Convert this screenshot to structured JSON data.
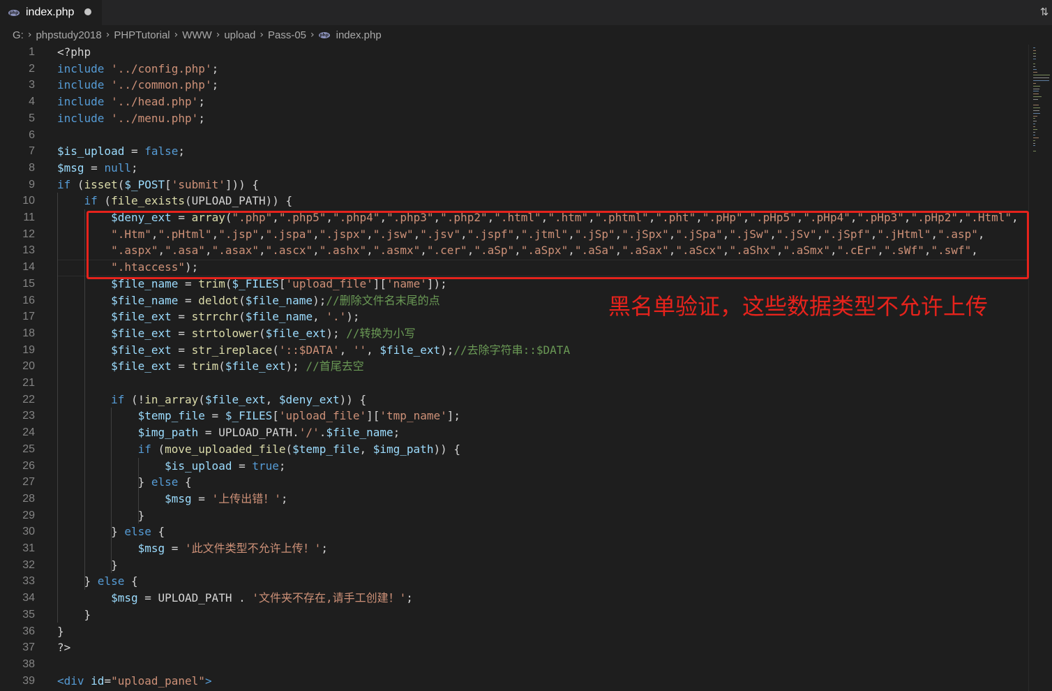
{
  "tab": {
    "title": "index.php",
    "icon": "php-file-icon"
  },
  "breadcrumb": [
    "G:",
    "phpstudy2018",
    "PHPTutorial",
    "WWW",
    "upload",
    "Pass-05",
    "index.php"
  ],
  "annotation": "黑名单验证，这些数据类型不允许上传",
  "colors": {
    "annotation": "#e6231c",
    "keyword": "#569cd6",
    "variable": "#9cdcfe",
    "function": "#dcdcaa",
    "string": "#ce9178",
    "comment": "#6a9955"
  },
  "code_lines": [
    {
      "n": "1",
      "t": [
        [
          "",
          "<?php"
        ]
      ]
    },
    {
      "n": "2",
      "t": [
        [
          "kw",
          "include"
        ],
        [
          "",
          " "
        ],
        [
          "str",
          "'../config.php'"
        ],
        [
          "",
          ";"
        ]
      ]
    },
    {
      "n": "3",
      "t": [
        [
          "kw",
          "include"
        ],
        [
          "",
          " "
        ],
        [
          "str",
          "'../common.php'"
        ],
        [
          "",
          ";"
        ]
      ]
    },
    {
      "n": "4",
      "t": [
        [
          "kw",
          "include"
        ],
        [
          "",
          " "
        ],
        [
          "str",
          "'../head.php'"
        ],
        [
          "",
          ";"
        ]
      ]
    },
    {
      "n": "5",
      "t": [
        [
          "kw",
          "include"
        ],
        [
          "",
          " "
        ],
        [
          "str",
          "'../menu.php'"
        ],
        [
          "",
          ";"
        ]
      ]
    },
    {
      "n": "6",
      "t": []
    },
    {
      "n": "7",
      "t": [
        [
          "var",
          "$is_upload"
        ],
        [
          "",
          " = "
        ],
        [
          "const",
          "false"
        ],
        [
          "",
          ";"
        ]
      ]
    },
    {
      "n": "8",
      "t": [
        [
          "var",
          "$msg"
        ],
        [
          "",
          " = "
        ],
        [
          "const",
          "null"
        ],
        [
          "",
          ";"
        ]
      ]
    },
    {
      "n": "9",
      "t": [
        [
          "kw",
          "if"
        ],
        [
          "",
          " ("
        ],
        [
          "fn",
          "isset"
        ],
        [
          "",
          "("
        ],
        [
          "var",
          "$_POST"
        ],
        [
          "",
          "["
        ],
        [
          "str",
          "'submit'"
        ],
        [
          "",
          "])) {"
        ]
      ]
    },
    {
      "n": "10",
      "t": [
        [
          "",
          "    "
        ],
        [
          "kw",
          "if"
        ],
        [
          "",
          " ("
        ],
        [
          "fn",
          "file_exists"
        ],
        [
          "",
          "(UPLOAD_PATH)) {"
        ]
      ]
    },
    {
      "n": "11",
      "t": [
        [
          "",
          "        "
        ],
        [
          "var",
          "$deny_ext"
        ],
        [
          "",
          " = "
        ],
        [
          "fn",
          "array"
        ],
        [
          "",
          "("
        ],
        [
          "str",
          "\".php\""
        ],
        [
          "",
          ","
        ],
        [
          "str",
          "\".php5\""
        ],
        [
          "",
          ","
        ],
        [
          "str",
          "\".php4\""
        ],
        [
          "",
          ","
        ],
        [
          "str",
          "\".php3\""
        ],
        [
          "",
          ","
        ],
        [
          "str",
          "\".php2\""
        ],
        [
          "",
          ","
        ],
        [
          "str",
          "\".html\""
        ],
        [
          "",
          ","
        ],
        [
          "str",
          "\".htm\""
        ],
        [
          "",
          ","
        ],
        [
          "str",
          "\".phtml\""
        ],
        [
          "",
          ","
        ],
        [
          "str",
          "\".pht\""
        ],
        [
          "",
          ","
        ],
        [
          "str",
          "\".pHp\""
        ],
        [
          "",
          ","
        ],
        [
          "str",
          "\".pHp5\""
        ],
        [
          "",
          ","
        ],
        [
          "str",
          "\".pHp4\""
        ],
        [
          "",
          ","
        ],
        [
          "str",
          "\".pHp3\""
        ],
        [
          "",
          ","
        ],
        [
          "str",
          "\".pHp2\""
        ],
        [
          "",
          ","
        ],
        [
          "str",
          "\".Html\""
        ],
        [
          "",
          ","
        ]
      ]
    },
    {
      "n": "12",
      "t": [
        [
          "",
          "        "
        ],
        [
          "str",
          "\".Htm\""
        ],
        [
          "",
          ","
        ],
        [
          "str",
          "\".pHtml\""
        ],
        [
          "",
          ","
        ],
        [
          "str",
          "\".jsp\""
        ],
        [
          "",
          ","
        ],
        [
          "str",
          "\".jspa\""
        ],
        [
          "",
          ","
        ],
        [
          "str",
          "\".jspx\""
        ],
        [
          "",
          ","
        ],
        [
          "str",
          "\".jsw\""
        ],
        [
          "",
          ","
        ],
        [
          "str",
          "\".jsv\""
        ],
        [
          "",
          ","
        ],
        [
          "str",
          "\".jspf\""
        ],
        [
          "",
          ","
        ],
        [
          "str",
          "\".jtml\""
        ],
        [
          "",
          ","
        ],
        [
          "str",
          "\".jSp\""
        ],
        [
          "",
          ","
        ],
        [
          "str",
          "\".jSpx\""
        ],
        [
          "",
          ","
        ],
        [
          "str",
          "\".jSpa\""
        ],
        [
          "",
          ","
        ],
        [
          "str",
          "\".jSw\""
        ],
        [
          "",
          ","
        ],
        [
          "str",
          "\".jSv\""
        ],
        [
          "",
          ","
        ],
        [
          "str",
          "\".jSpf\""
        ],
        [
          "",
          ","
        ],
        [
          "str",
          "\".jHtml\""
        ],
        [
          "",
          ","
        ],
        [
          "str",
          "\".asp\""
        ],
        [
          "",
          ","
        ]
      ]
    },
    {
      "n": "13",
      "t": [
        [
          "",
          "        "
        ],
        [
          "str",
          "\".aspx\""
        ],
        [
          "",
          ","
        ],
        [
          "str",
          "\".asa\""
        ],
        [
          "",
          ","
        ],
        [
          "str",
          "\".asax\""
        ],
        [
          "",
          ","
        ],
        [
          "str",
          "\".ascx\""
        ],
        [
          "",
          ","
        ],
        [
          "str",
          "\".ashx\""
        ],
        [
          "",
          ","
        ],
        [
          "str",
          "\".asmx\""
        ],
        [
          "",
          ","
        ],
        [
          "str",
          "\".cer\""
        ],
        [
          "",
          ","
        ],
        [
          "str",
          "\".aSp\""
        ],
        [
          "",
          ","
        ],
        [
          "str",
          "\".aSpx\""
        ],
        [
          "",
          ","
        ],
        [
          "str",
          "\".aSa\""
        ],
        [
          "",
          ","
        ],
        [
          "str",
          "\".aSax\""
        ],
        [
          "",
          ","
        ],
        [
          "str",
          "\".aScx\""
        ],
        [
          "",
          ","
        ],
        [
          "str",
          "\".aShx\""
        ],
        [
          "",
          ","
        ],
        [
          "str",
          "\".aSmx\""
        ],
        [
          "",
          ","
        ],
        [
          "str",
          "\".cEr\""
        ],
        [
          "",
          ","
        ],
        [
          "str",
          "\".sWf\""
        ],
        [
          "",
          ","
        ],
        [
          "str",
          "\".swf\""
        ],
        [
          "",
          ","
        ]
      ]
    },
    {
      "n": "14",
      "t": [
        [
          "",
          "        "
        ],
        [
          "str",
          "\".htaccess\""
        ],
        [
          "",
          ");"
        ]
      ]
    },
    {
      "n": "15",
      "t": [
        [
          "",
          "        "
        ],
        [
          "var",
          "$file_name"
        ],
        [
          "",
          " = "
        ],
        [
          "fn",
          "trim"
        ],
        [
          "",
          "("
        ],
        [
          "var",
          "$_FILES"
        ],
        [
          "",
          "["
        ],
        [
          "str",
          "'upload_file'"
        ],
        [
          "",
          "]["
        ],
        [
          "str",
          "'name'"
        ],
        [
          "",
          "]);"
        ]
      ]
    },
    {
      "n": "16",
      "t": [
        [
          "",
          "        "
        ],
        [
          "var",
          "$file_name"
        ],
        [
          "",
          " = "
        ],
        [
          "fn",
          "deldot"
        ],
        [
          "",
          "("
        ],
        [
          "var",
          "$file_name"
        ],
        [
          "",
          ");"
        ],
        [
          "cm",
          "//删除文件名末尾的点"
        ]
      ]
    },
    {
      "n": "17",
      "t": [
        [
          "",
          "        "
        ],
        [
          "var",
          "$file_ext"
        ],
        [
          "",
          " = "
        ],
        [
          "fn",
          "strrchr"
        ],
        [
          "",
          "("
        ],
        [
          "var",
          "$file_name"
        ],
        [
          "",
          ", "
        ],
        [
          "str",
          "'.'"
        ],
        [
          "",
          ");"
        ]
      ]
    },
    {
      "n": "18",
      "t": [
        [
          "",
          "        "
        ],
        [
          "var",
          "$file_ext"
        ],
        [
          "",
          " = "
        ],
        [
          "fn",
          "strtolower"
        ],
        [
          "",
          "("
        ],
        [
          "var",
          "$file_ext"
        ],
        [
          "",
          "); "
        ],
        [
          "cm",
          "//转换为小写"
        ]
      ]
    },
    {
      "n": "19",
      "t": [
        [
          "",
          "        "
        ],
        [
          "var",
          "$file_ext"
        ],
        [
          "",
          " = "
        ],
        [
          "fn",
          "str_ireplace"
        ],
        [
          "",
          "("
        ],
        [
          "str",
          "'::$DATA'"
        ],
        [
          "",
          ", "
        ],
        [
          "str",
          "''"
        ],
        [
          "",
          ", "
        ],
        [
          "var",
          "$file_ext"
        ],
        [
          "",
          ");"
        ],
        [
          "cm",
          "//去除字符串::$DATA"
        ]
      ]
    },
    {
      "n": "20",
      "t": [
        [
          "",
          "        "
        ],
        [
          "var",
          "$file_ext"
        ],
        [
          "",
          " = "
        ],
        [
          "fn",
          "trim"
        ],
        [
          "",
          "("
        ],
        [
          "var",
          "$file_ext"
        ],
        [
          "",
          "); "
        ],
        [
          "cm",
          "//首尾去空"
        ]
      ]
    },
    {
      "n": "21",
      "t": []
    },
    {
      "n": "22",
      "t": [
        [
          "",
          "        "
        ],
        [
          "kw",
          "if"
        ],
        [
          "",
          " (!"
        ],
        [
          "fn",
          "in_array"
        ],
        [
          "",
          "("
        ],
        [
          "var",
          "$file_ext"
        ],
        [
          "",
          ", "
        ],
        [
          "var",
          "$deny_ext"
        ],
        [
          "",
          ")) {"
        ]
      ]
    },
    {
      "n": "23",
      "t": [
        [
          "",
          "            "
        ],
        [
          "var",
          "$temp_file"
        ],
        [
          "",
          " = "
        ],
        [
          "var",
          "$_FILES"
        ],
        [
          "",
          "["
        ],
        [
          "str",
          "'upload_file'"
        ],
        [
          "",
          "]["
        ],
        [
          "str",
          "'tmp_name'"
        ],
        [
          "",
          "];"
        ]
      ]
    },
    {
      "n": "24",
      "t": [
        [
          "",
          "            "
        ],
        [
          "var",
          "$img_path"
        ],
        [
          "",
          " = UPLOAD_PATH."
        ],
        [
          "str",
          "'/'"
        ],
        [
          "",
          "."
        ],
        [
          "var",
          "$file_name"
        ],
        [
          "",
          ";"
        ]
      ]
    },
    {
      "n": "25",
      "t": [
        [
          "",
          "            "
        ],
        [
          "kw",
          "if"
        ],
        [
          "",
          " ("
        ],
        [
          "fn",
          "move_uploaded_file"
        ],
        [
          "",
          "("
        ],
        [
          "var",
          "$temp_file"
        ],
        [
          "",
          ", "
        ],
        [
          "var",
          "$img_path"
        ],
        [
          "",
          ")) {"
        ]
      ]
    },
    {
      "n": "26",
      "t": [
        [
          "",
          "                "
        ],
        [
          "var",
          "$is_upload"
        ],
        [
          "",
          " = "
        ],
        [
          "const",
          "true"
        ],
        [
          "",
          ";"
        ]
      ]
    },
    {
      "n": "27",
      "t": [
        [
          "",
          "            } "
        ],
        [
          "kw",
          "else"
        ],
        [
          "",
          " {"
        ]
      ]
    },
    {
      "n": "28",
      "t": [
        [
          "",
          "                "
        ],
        [
          "var",
          "$msg"
        ],
        [
          "",
          " = "
        ],
        [
          "str",
          "'上传出错！'"
        ],
        [
          "",
          ";"
        ]
      ]
    },
    {
      "n": "29",
      "t": [
        [
          "",
          "            }"
        ]
      ]
    },
    {
      "n": "30",
      "t": [
        [
          "",
          "        } "
        ],
        [
          "kw",
          "else"
        ],
        [
          "",
          " {"
        ]
      ]
    },
    {
      "n": "31",
      "t": [
        [
          "",
          "            "
        ],
        [
          "var",
          "$msg"
        ],
        [
          "",
          " = "
        ],
        [
          "str",
          "'此文件类型不允许上传！'"
        ],
        [
          "",
          ";"
        ]
      ]
    },
    {
      "n": "32",
      "t": [
        [
          "",
          "        }"
        ]
      ]
    },
    {
      "n": "33",
      "t": [
        [
          "",
          "    } "
        ],
        [
          "kw",
          "else"
        ],
        [
          "",
          " {"
        ]
      ]
    },
    {
      "n": "34",
      "t": [
        [
          "",
          "        "
        ],
        [
          "var",
          "$msg"
        ],
        [
          "",
          " = UPLOAD_PATH . "
        ],
        [
          "str",
          "'文件夹不存在,请手工创建！'"
        ],
        [
          "",
          ";"
        ]
      ]
    },
    {
      "n": "35",
      "t": [
        [
          "",
          "    }"
        ]
      ]
    },
    {
      "n": "36",
      "t": [
        [
          "",
          "}"
        ]
      ]
    },
    {
      "n": "37",
      "t": [
        [
          "",
          "?>"
        ]
      ]
    },
    {
      "n": "38",
      "t": []
    },
    {
      "n": "39",
      "t": [
        [
          "tag",
          "<div"
        ],
        [
          "",
          " "
        ],
        [
          "attr",
          "id"
        ],
        [
          "",
          "="
        ],
        [
          "str",
          "\"upload_panel\""
        ],
        [
          "tag",
          ">"
        ]
      ]
    }
  ]
}
